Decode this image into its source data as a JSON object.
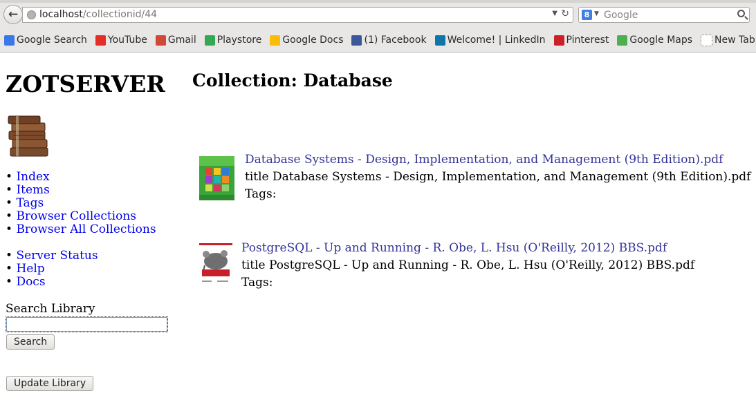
{
  "browser": {
    "url_host": "localhost",
    "url_path": "/collectionid/44",
    "search_placeholder": "Google",
    "search_engine_badge": "8",
    "bookmarks": [
      {
        "label": "Google Search",
        "icon": "google-search-icon",
        "color": "#3b78e7"
      },
      {
        "label": "YouTube",
        "icon": "youtube-icon",
        "color": "#e52d27"
      },
      {
        "label": "Gmail",
        "icon": "gmail-icon",
        "color": "#d14836"
      },
      {
        "label": "Playstore",
        "icon": "playstore-icon",
        "color": "#34a853"
      },
      {
        "label": "Google Docs",
        "icon": "google-drive-icon",
        "color": "#fbbc05"
      },
      {
        "label": "(1) Facebook",
        "icon": "facebook-icon",
        "color": "#3b5998"
      },
      {
        "label": "Welcome! | LinkedIn",
        "icon": "linkedin-icon",
        "color": "#0e76a8"
      },
      {
        "label": "Pinterest",
        "icon": "pinterest-icon",
        "color": "#cb2027"
      },
      {
        "label": "Google Maps",
        "icon": "google-maps-icon",
        "color": "#4caf50"
      },
      {
        "label": "New Tab",
        "icon": "new-tab-icon",
        "color": "#ffffff"
      }
    ]
  },
  "site": {
    "title": "ZOTSERVER",
    "nav_primary": [
      "Index",
      "Items",
      "Tags",
      "Browser Collections",
      "Browser All Collections"
    ],
    "nav_secondary": [
      "Server Status",
      "Help",
      "Docs"
    ],
    "search_label": "Search Library",
    "search_value": "",
    "search_button": "Search",
    "update_button": "Update Library"
  },
  "collection": {
    "heading": "Collection: Database",
    "items": [
      {
        "link": "Database Systems - Design, Implementation, and Management (9th Edition).pdf",
        "title_line": "title Database Systems - Design, Implementation, and Management (9th Edition).pdf",
        "tags_line": "Tags:"
      },
      {
        "link": "PostgreSQL - Up and Running - R. Obe, L. Hsu (O'Reilly, 2012) BBS.pdf",
        "title_line": "title PostgreSQL - Up and Running - R. Obe, L. Hsu (O'Reilly, 2012) BBS.pdf",
        "tags_line": "Tags:"
      }
    ]
  },
  "colors": {
    "link_blue": "#0000ee",
    "item_link": "#333399"
  }
}
